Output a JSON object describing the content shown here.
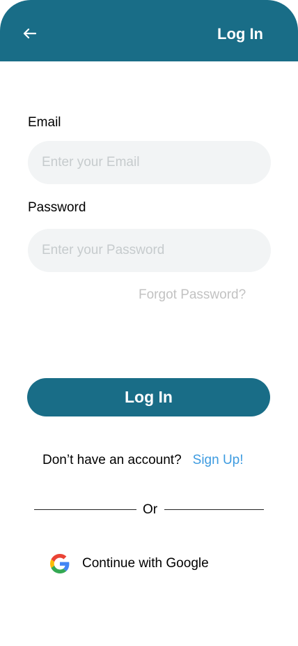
{
  "header": {
    "title": "Log In",
    "back_icon": "arrow-left-icon",
    "color": "#196d87"
  },
  "form": {
    "email_label": "Email",
    "email_placeholder": "Enter your Email",
    "password_label": "Password",
    "password_placeholder": "Enter your Password",
    "forgot_label": "Forgot Password?"
  },
  "actions": {
    "login_label": "Log In",
    "no_account_text": "Don’t have an account?",
    "signup_label": "Sign Up!",
    "or_text": "Or",
    "google_label": "Continue with Google",
    "google_icon": "google-icon",
    "link_color": "#3d9be0"
  }
}
